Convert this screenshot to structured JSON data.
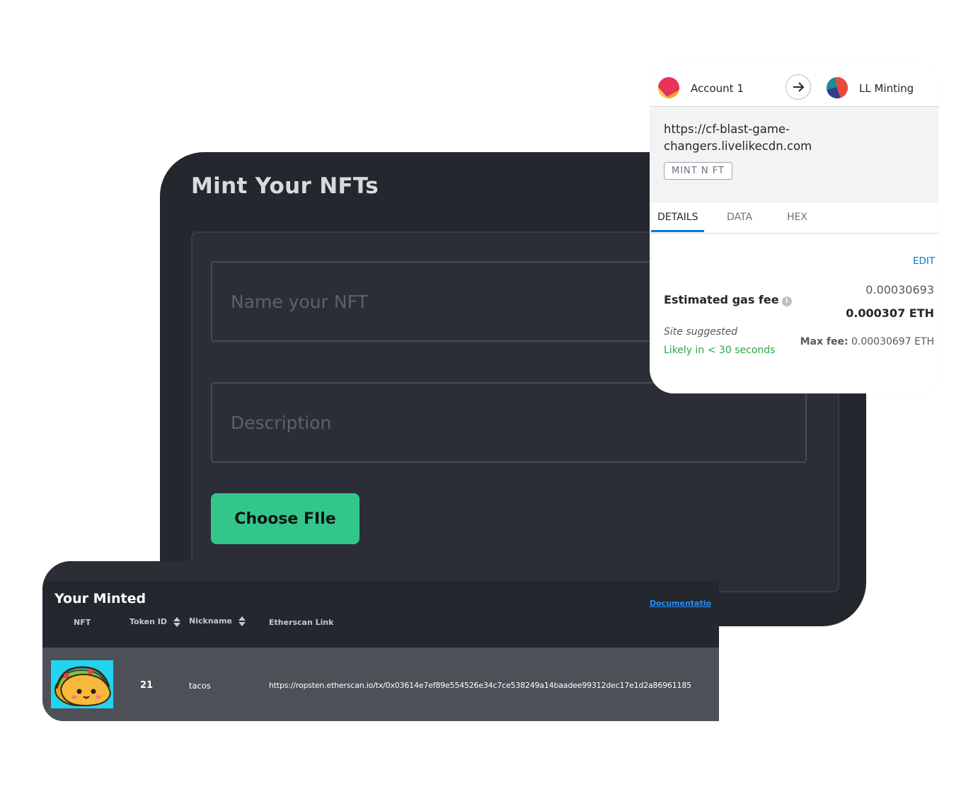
{
  "mint": {
    "title": "Mint Your NFTs",
    "name_placeholder": "Name your NFT",
    "description_placeholder": "Description",
    "choose_file_label": "Choose FIle"
  },
  "minted": {
    "title": "Your Minted",
    "documentation_link": "Documentatio",
    "columns": {
      "nft": "NFT",
      "token_id": "Token ID",
      "nickname": "Nickname",
      "etherscan": "Etherscan Link"
    },
    "rows": [
      {
        "image": "taco-nft-image",
        "token_id": "21",
        "nickname": "tacos",
        "etherscan_link": "https://ropsten.etherscan.io/tx/0x03614e7ef89e554526e34c7ce538249a14baadee99312dec17e1d2a86961185"
      }
    ]
  },
  "wallet": {
    "from_account": "Account 1",
    "to_account": "LL Minting",
    "site_url": "https://cf-blast-game-changers.livelikecdn.com",
    "method": "MINT N FT",
    "tabs": [
      "DETAILS",
      "DATA",
      "HEX"
    ],
    "active_tab": "DETAILS",
    "edit_label": "EDIT",
    "gas_fee_label": "Estimated gas fee",
    "gas_fee_secondary": "0.00030693",
    "gas_fee_primary": "0.000307 ETH",
    "site_suggested": "Site suggested",
    "likely_time": "Likely in < 30 seconds",
    "max_fee_label": "Max fee:",
    "max_fee_value": "0.00030697 ETH"
  },
  "colors": {
    "mint_panel_bg": "#24272e",
    "accent_green": "#33c68a",
    "link_blue": "#037dd6",
    "success_green": "#28a745"
  }
}
